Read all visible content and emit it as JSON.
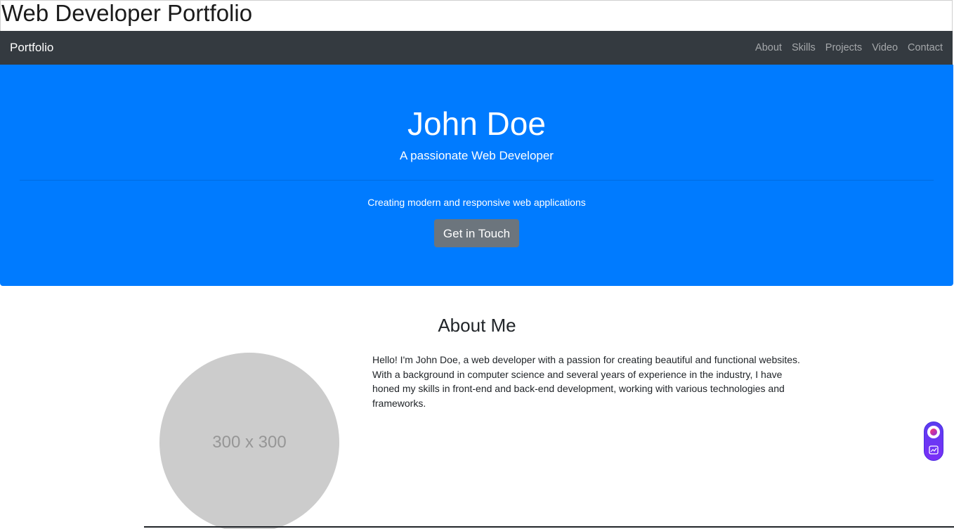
{
  "page": {
    "heading": "Web Developer Portfolio"
  },
  "navbar": {
    "brand": "Portfolio",
    "links": [
      "About",
      "Skills",
      "Projects",
      "Video",
      "Contact"
    ]
  },
  "hero": {
    "name": "John Doe",
    "lead": "A passionate Web Developer",
    "sub": "Creating modern and responsive web applications",
    "button": "Get in Touch"
  },
  "about": {
    "title": "About Me",
    "image_placeholder": "300 x 300",
    "text": "Hello! I'm John Doe, a web developer with a passion for creating beautiful and functional websites. With a background in computer science and several years of experience in the industry, I have honed my skills in front-end and back-end development, working with various technologies and frameworks."
  },
  "extension_widget": {
    "icons": [
      "extension-logo-icon",
      "chart-sparkle-icon"
    ]
  },
  "colors": {
    "navbar_bg": "#343a40",
    "hero_bg": "#007bff",
    "button_bg": "#6c757d",
    "placeholder_bg": "#cccccc"
  }
}
